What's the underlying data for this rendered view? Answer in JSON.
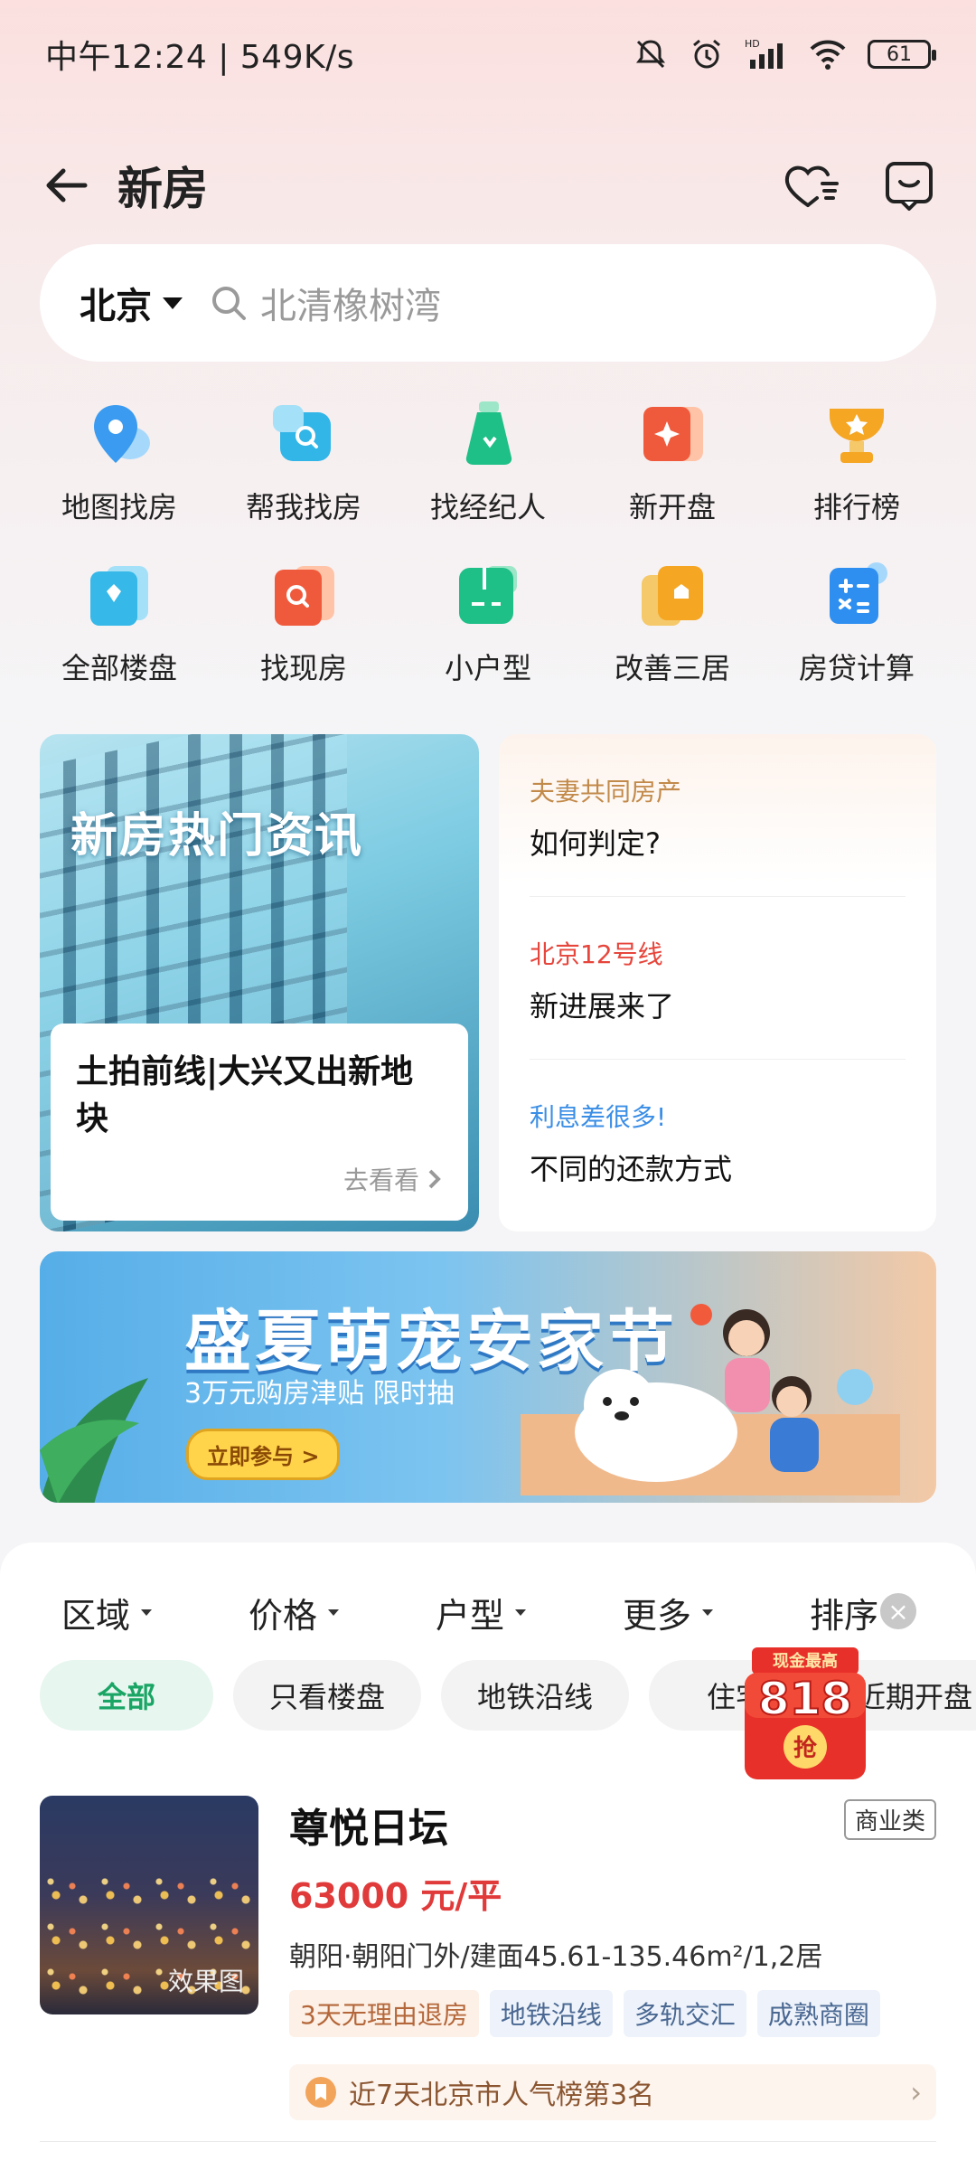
{
  "status_bar": {
    "time_speed": "中午12:24 | 549K/s",
    "battery": "61"
  },
  "header": {
    "title": "新房"
  },
  "search": {
    "city": "北京",
    "placeholder": "北清橡树湾"
  },
  "grid": [
    {
      "label": "地图找房",
      "icon": "map-pin-icon",
      "color": "#3a9bf0"
    },
    {
      "label": "帮我找房",
      "icon": "search-home-icon",
      "color": "#32b6e8"
    },
    {
      "label": "找经纪人",
      "icon": "agent-icon",
      "color": "#1fbf88"
    },
    {
      "label": "新开盘",
      "icon": "new-open-icon",
      "color": "#f05a3c"
    },
    {
      "label": "排行榜",
      "icon": "trophy-icon",
      "color": "#f5a623"
    },
    {
      "label": "全部楼盘",
      "icon": "all-buildings-icon",
      "color": "#36b8e8"
    },
    {
      "label": "找现房",
      "icon": "find-ready-icon",
      "color": "#f05a3c"
    },
    {
      "label": "小户型",
      "icon": "small-unit-icon",
      "color": "#1fbf88"
    },
    {
      "label": "改善三居",
      "icon": "three-bedroom-icon",
      "color": "#f5a623"
    },
    {
      "label": "房贷计算",
      "icon": "calculator-icon",
      "color": "#2f8ff0"
    }
  ],
  "news": {
    "headline": "新房热门资讯",
    "card_title": "土拍前线|大兴又出新地块",
    "go": "去看看",
    "topics": [
      {
        "tag": "夫妻共同房产",
        "text": "如何判定?",
        "color": "#c28a4a"
      },
      {
        "tag": "北京12号线",
        "text": "新进展来了",
        "color": "#e6463c"
      },
      {
        "tag": "利息差很多!",
        "text": "不同的还款方式",
        "color": "#3a8ee6"
      }
    ]
  },
  "promo": {
    "title": "盛夏萌宠安家节",
    "subtitle": "3万元购房津贴 限时抽",
    "button": "立即参与 >"
  },
  "filters": [
    "区域",
    "价格",
    "户型",
    "更多",
    "排序"
  ],
  "chips": [
    "全部",
    "只看楼盘",
    "地铁沿线",
    "住宅",
    "近期开盘"
  ],
  "redpack": {
    "top": "现金最高",
    "amount": "818",
    "action": "抢"
  },
  "listing": {
    "name": "尊悦日坛",
    "type": "商业类",
    "price": "63000 元/平",
    "location": "朝阳·朝阳门外/建面45.61-135.46m²/1,2居",
    "thumb_label": "效果图",
    "tags": [
      "3天无理由退房",
      "地铁沿线",
      "多轨交汇",
      "成熟商圈"
    ],
    "rank": "近7天北京市人气榜第3名"
  }
}
